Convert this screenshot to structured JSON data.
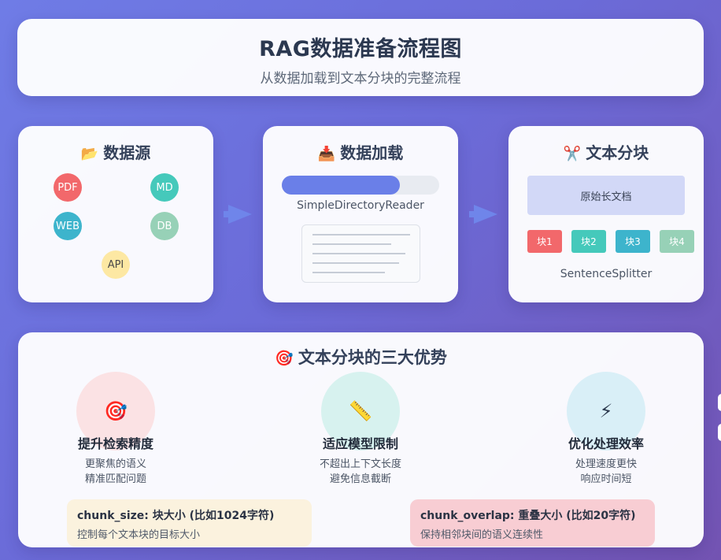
{
  "header": {
    "title": "RAG数据准备流程图",
    "subtitle": "从数据加载到文本分块的完整流程"
  },
  "steps": {
    "source": {
      "icon": "folder-icon",
      "icon_glyph": "📂",
      "title": "数据源",
      "items": [
        "PDF",
        "MD",
        "WEB",
        "DB",
        "API"
      ]
    },
    "load": {
      "icon": "inbox-tray-icon",
      "icon_glyph": "📥",
      "title": "数据加载",
      "progress": 0.75,
      "reader": "SimpleDirectoryReader"
    },
    "split": {
      "icon": "scissors-icon",
      "icon_glyph": "✂️",
      "title": "文本分块",
      "original": "原始长文档",
      "chunks": [
        "块1",
        "块2",
        "块3",
        "块4"
      ],
      "splitter": "SentenceSplitter"
    }
  },
  "advantages": {
    "icon": "target-icon",
    "icon_glyph": "🎯",
    "title": "文本分块的三大优势",
    "items": [
      {
        "icon": "target-icon",
        "glyph": "🎯",
        "name": "提升检索精度",
        "lines": [
          "更聚焦的语义",
          "精准匹配问题"
        ]
      },
      {
        "icon": "ruler-icon",
        "glyph": "📏",
        "name": "适应模型限制",
        "lines": [
          "不超出上下文长度",
          "避免信息截断"
        ]
      },
      {
        "icon": "lightning-icon",
        "glyph": "⚡",
        "name": "优化处理效率",
        "lines": [
          "处理速度更快",
          "响应时间短"
        ]
      }
    ],
    "params": [
      {
        "key": "chunk_size: 块大小 (比如1024字符)",
        "desc": "控制每个文本块的目标大小"
      },
      {
        "key": "chunk_overlap: 重叠大小 (比如20字符)",
        "desc": "保持相邻块间的语义连续性"
      }
    ]
  },
  "colors": {
    "red": "#f2686b",
    "teal": "#45c9bb",
    "cyan": "#3db4cc",
    "green": "#97d1b7",
    "yellow": "#fde8a3",
    "accent": "#6a7fe8"
  }
}
